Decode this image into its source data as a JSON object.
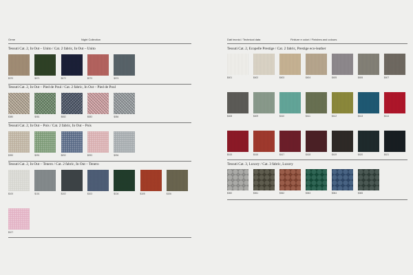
{
  "left": {
    "header_left": "Orme",
    "header_center": "Night Collection",
    "groups": [
      {
        "title": "Tessuti Cat. 2, In Out – Unito / Cat. 2 fabric, In Out – Unito",
        "swatches": [
          {
            "code": "$070",
            "color": "#a38e76",
            "texture": "weave"
          },
          {
            "code": "$071",
            "color": "#2f4226",
            "texture": "weave"
          },
          {
            "code": "$072",
            "color": "#1b2038",
            "texture": "weave"
          },
          {
            "code": "$073",
            "color": "#b66460",
            "texture": "weave"
          },
          {
            "code": "$074",
            "color": "#59646a",
            "texture": "weave"
          }
        ]
      },
      {
        "title": "Tessuti Cat. 2, In Out – Pied de Poul / Cat. 2 fabric, In Out – Pied de Poul",
        "swatches": [
          {
            "code": "$080",
            "color": "#b8ab98",
            "texture": "hound"
          },
          {
            "code": "$081",
            "color": "#6f8c6c",
            "texture": "hound"
          },
          {
            "code": "$082",
            "color": "#4c5668",
            "texture": "hound"
          },
          {
            "code": "$083",
            "color": "#d4a4a6",
            "texture": "hound"
          },
          {
            "code": "$084",
            "color": "#9aa0a3",
            "texture": "hound"
          }
        ]
      },
      {
        "title": "Tessuti Cat. 2, In Out – Pois / Cat. 2 fabric, In Out – Pois",
        "swatches": [
          {
            "code": "$090",
            "color": "#bdb2a0",
            "texture": "dots"
          },
          {
            "code": "$091",
            "color": "#7c9a76",
            "texture": "dots"
          },
          {
            "code": "$092",
            "color": "#596a86",
            "texture": "dots"
          },
          {
            "code": "$093",
            "color": "#d8aeb0",
            "texture": "dots"
          },
          {
            "code": "$094",
            "color": "#a4aaad",
            "texture": "dots"
          }
        ]
      },
      {
        "title": "Tessuti Cat. 2, In Out – Tenero / Cat. 2 fabric, In Out – Tenero",
        "swatches": [
          {
            "code": "$100",
            "color": "#d6d6d0",
            "texture": "dots"
          },
          {
            "code": "$101",
            "color": "#868c8e",
            "texture": "weave"
          },
          {
            "code": "$102",
            "color": "#3e4447",
            "texture": "weave"
          },
          {
            "code": "$103",
            "color": "#4f5f78",
            "texture": "weave"
          },
          {
            "code": "$104",
            "color": "#223e2c",
            "texture": "weave"
          },
          {
            "code": "$105",
            "color": "#a53d27",
            "texture": "weave"
          },
          {
            "code": "$106",
            "color": "#6b6650",
            "texture": "weave"
          },
          {
            "code": "$107",
            "color": "#e3b3c5",
            "texture": "dots"
          }
        ]
      }
    ]
  },
  "right": {
    "header_left": "Dati tecnici / Technical data",
    "header_center": "Finiture e colori / Finishes and colours",
    "groups": [
      {
        "title": "Tessuti Cat. 2, Ecopelle Prestige / Cat. 2 fabric, Prestige eco-leather",
        "rows": [
          [
            {
              "code": "$401",
              "color": "#f3f2ee",
              "texture": "weave"
            },
            {
              "code": "$402",
              "color": "#ddd6c8",
              "texture": "weave"
            },
            {
              "code": "$403",
              "color": "#c9b595",
              "texture": "weave"
            },
            {
              "code": "$404",
              "color": "#b9a88f",
              "texture": "weave"
            },
            {
              "code": "$405",
              "color": "#8f8a8e",
              "texture": "weave"
            },
            {
              "code": "$406",
              "color": "#858278",
              "texture": "weave"
            },
            {
              "code": "$407",
              "color": "#706a62",
              "texture": "weave"
            }
          ],
          [
            {
              "code": "$408",
              "color": "#5d5c58",
              "texture": "weave"
            },
            {
              "code": "$409",
              "color": "#8b9c8d",
              "texture": "weave"
            },
            {
              "code": "$410",
              "color": "#64a89b",
              "texture": "weave"
            },
            {
              "code": "$411",
              "color": "#6a7253",
              "texture": "weave"
            },
            {
              "code": "$412",
              "color": "#8d8a3c",
              "texture": "weave"
            },
            {
              "code": "$413",
              "color": "#1f5a75",
              "texture": "weave"
            },
            {
              "code": "$414",
              "color": "#b1162a",
              "texture": "weave"
            }
          ],
          [
            {
              "code": "$415",
              "color": "#8e1a27",
              "texture": "weave"
            },
            {
              "code": "$416",
              "color": "#a23a2e",
              "texture": "weave"
            },
            {
              "code": "$417",
              "color": "#6e1f2a",
              "texture": "weave"
            },
            {
              "code": "$418",
              "color": "#4c2126",
              "texture": "weave"
            },
            {
              "code": "$419",
              "color": "#2f2a27",
              "texture": "weave"
            },
            {
              "code": "$420",
              "color": "#1f2b2d",
              "texture": "weave"
            },
            {
              "code": "$421",
              "color": "#181e22",
              "texture": "weave"
            }
          ]
        ]
      },
      {
        "title": "Tessuti Cat. 3, Luxory / Cat. 3 fabric, Luxory",
        "rows": [
          [
            {
              "code": "$060",
              "color": "#9e9e9b",
              "texture": "quilt"
            },
            {
              "code": "$061",
              "color": "#484536",
              "texture": "quilt"
            },
            {
              "code": "$062",
              "color": "#8b4530",
              "texture": "quilt"
            },
            {
              "code": "$063",
              "color": "#12503c",
              "texture": "quilt"
            },
            {
              "code": "$064",
              "color": "#2f4d72",
              "texture": "quilt"
            },
            {
              "code": "$065",
              "color": "#31413b",
              "texture": "quilt"
            }
          ]
        ]
      }
    ]
  }
}
